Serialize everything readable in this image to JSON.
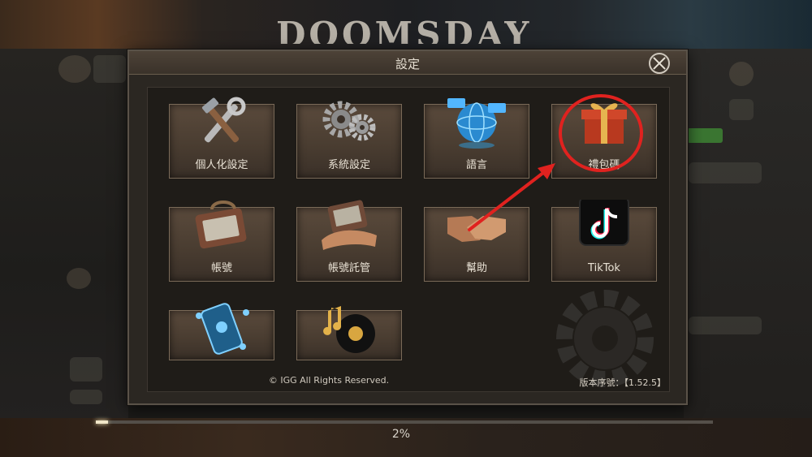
{
  "background": {
    "game_logo_text": "DOOMSDAY",
    "progress": {
      "percent": 0.02,
      "label": "2%"
    }
  },
  "dialog": {
    "title": "設定",
    "tiles": [
      {
        "label": "個人化設定",
        "icon": "tools-icon"
      },
      {
        "label": "系統設定",
        "icon": "gears-icon"
      },
      {
        "label": "語言",
        "icon": "globe-icon"
      },
      {
        "label": "禮包碼",
        "icon": "gift-icon"
      },
      {
        "label": "帳號",
        "icon": "id-badge-icon"
      },
      {
        "label": "帳號託管",
        "icon": "hand-badge-icon"
      },
      {
        "label": "幫助",
        "icon": "handshake-icon"
      },
      {
        "label": "TikTok",
        "icon": "tiktok-icon"
      },
      {
        "label": "",
        "icon": "phone-network-icon"
      },
      {
        "label": "",
        "icon": "record-music-icon"
      }
    ],
    "copyright": "© IGG All Rights Reserved.",
    "version": "版本序號：【1.52.5】"
  },
  "annotation": {
    "color": "#e0221f"
  }
}
